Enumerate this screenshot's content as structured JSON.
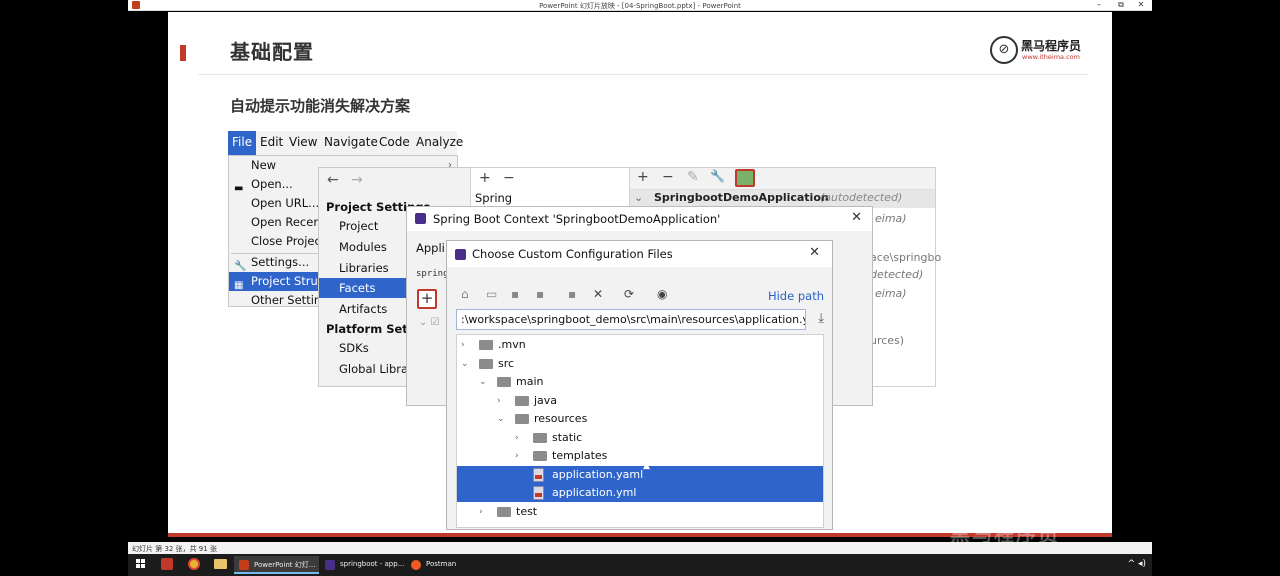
{
  "window": {
    "title": "PowerPoint 幻灯片放映 - [04-SpringBoot.pptx] - PowerPoint",
    "controls": {
      "minimize": "–",
      "restore": "⧉",
      "close": "✕"
    }
  },
  "slide": {
    "title": "基础配置",
    "subtitle": "自动提示功能消失解决方案",
    "brand": {
      "logo_char": "⊘",
      "name": "黑马程序员",
      "url": "www.itheima.com"
    },
    "accent_color": "#c0392b"
  },
  "ide": {
    "menubar": [
      "File",
      "Edit",
      "View",
      "Navigate",
      "Code",
      "Analyze"
    ],
    "file_menu": [
      {
        "label": "New",
        "arrow": "›"
      },
      {
        "label": "Open...",
        "icon": "folder-icon"
      },
      {
        "label": "Open URL..."
      },
      {
        "label": "Open Recent"
      },
      {
        "label": "Close Project"
      },
      {
        "label": "Settings...",
        "icon": "wrench-icon"
      },
      {
        "label": "Project Struct",
        "icon": "project-structure-icon",
        "selected": true
      },
      {
        "label": "Other Setting"
      }
    ],
    "project_structure": {
      "nav_back": "←",
      "nav_forward": "→",
      "project_settings_header": "Project Settings",
      "project_settings": [
        "Project",
        "Modules",
        "Libraries",
        "Facets",
        "Artifacts"
      ],
      "selected": "Facets",
      "platform_settings_header": "Platform Settin",
      "platform_settings": [
        "SDKs",
        "Global Librari"
      ]
    },
    "facets": {
      "add": "+",
      "remove": "−",
      "item": "Spring"
    },
    "spring_context": {
      "toolbar": [
        "+",
        "−",
        "✎",
        "🔧"
      ],
      "context_name": "SpringbootDemoApplication",
      "autodetected": "(autodetected)",
      "ghost_texts": [
        "eima)",
        "ace\\springbo",
        "detected)",
        "eima)",
        "urces)"
      ]
    },
    "spring_boot_dialog": {
      "title": "Spring Boot Context 'SpringbootDemoApplication'",
      "close": "✕",
      "application_label": "Appli",
      "mono_text": "spring",
      "add_button": "+"
    },
    "choose_files_dialog": {
      "title": "Choose Custom Configuration Files",
      "close": "✕",
      "hide_path": "Hide path",
      "path": ":\\workspace\\springboot_demo\\src\\main\\resources\\application.yaml",
      "download_icon": "⤓",
      "tree": [
        {
          "label": ".mvn",
          "indent": 0,
          "expanded": false,
          "type": "folder"
        },
        {
          "label": "src",
          "indent": 0,
          "expanded": true,
          "type": "folder"
        },
        {
          "label": "main",
          "indent": 1,
          "expanded": true,
          "type": "folder"
        },
        {
          "label": "java",
          "indent": 2,
          "expanded": false,
          "type": "folder"
        },
        {
          "label": "resources",
          "indent": 2,
          "expanded": true,
          "type": "folder"
        },
        {
          "label": "static",
          "indent": 3,
          "expanded": false,
          "type": "folder"
        },
        {
          "label": "templates",
          "indent": 3,
          "expanded": false,
          "type": "folder"
        },
        {
          "label": "application.yaml",
          "indent": 3,
          "type": "file",
          "selected": true
        },
        {
          "label": "application.yml",
          "indent": 3,
          "type": "file",
          "selected": true
        },
        {
          "label": "test",
          "indent": 1,
          "expanded": false,
          "type": "folder"
        }
      ]
    }
  },
  "statusbar": {
    "text": "幻灯片 第 32 张，共 91 张"
  },
  "watermark": "黑马程序员",
  "taskbar": {
    "apps": [
      {
        "label": "PowerPoint 幻灯...",
        "color": "#c43e1c",
        "active": true
      },
      {
        "label": "springboot - app...",
        "color": "#4a2f8a",
        "active": false
      },
      {
        "label": "Postman",
        "color": "#ef5b25",
        "active": false
      }
    ],
    "tray": "^ ◂)"
  }
}
